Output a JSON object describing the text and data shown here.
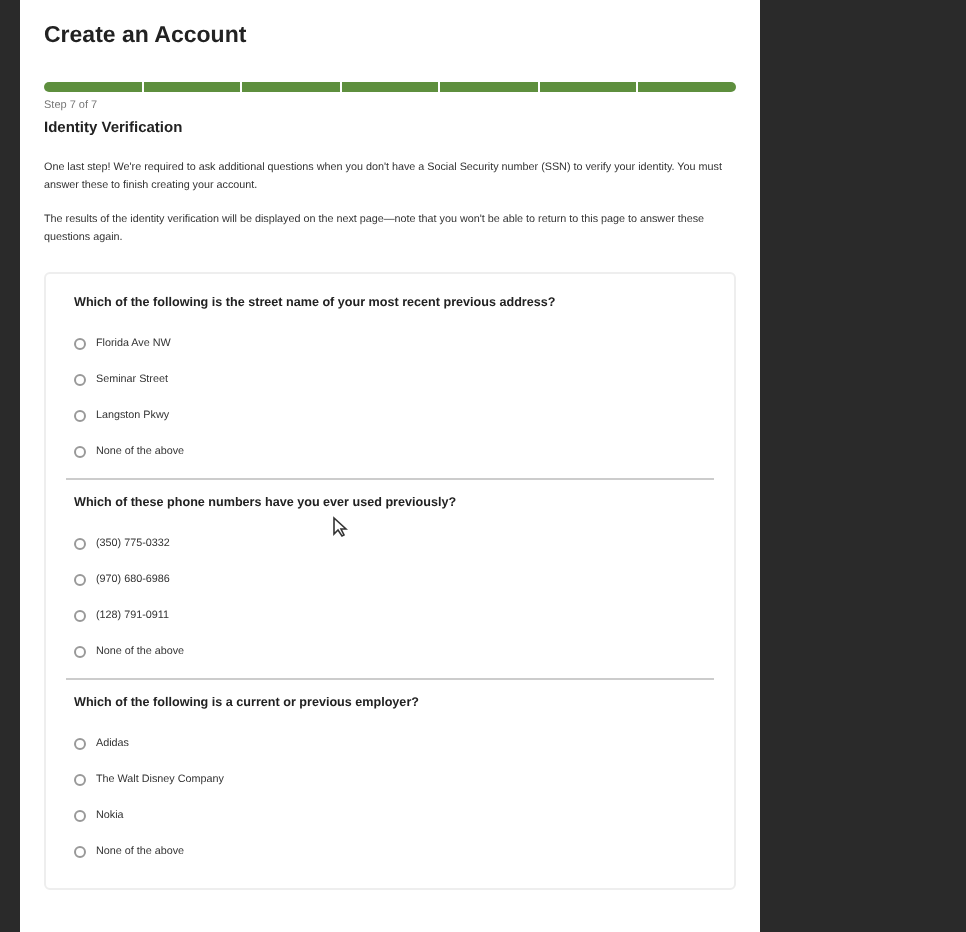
{
  "page": {
    "title": "Create an Account"
  },
  "progress": {
    "segments": [
      {
        "completed": true
      },
      {
        "completed": true
      },
      {
        "completed": true
      },
      {
        "completed": true
      },
      {
        "completed": true
      },
      {
        "completed": true
      },
      {
        "completed": true
      }
    ],
    "step_label": "Step 7 of 7"
  },
  "section": {
    "heading": "Identity Verification",
    "paragraphs": [
      "One last step! We're required to ask additional questions when you don't have a Social Security number (SSN) to verify your identity. You must answer these to finish creating your account.",
      "The results of the identity verification will be displayed on the next page—note that you won't be able to return to this page to answer these questions again."
    ]
  },
  "questions": [
    {
      "question": "Which of the following is the street name of your most recent previous address?",
      "options": [
        {
          "label": "Florida Ave NW",
          "selected": false
        },
        {
          "label": "Seminar Street",
          "selected": false
        },
        {
          "label": "Langston Pkwy",
          "selected": false
        },
        {
          "label": "None of the above",
          "selected": false
        }
      ]
    },
    {
      "question": "Which of these phone numbers have you ever used previously?",
      "options": [
        {
          "label": "(350) 775-0332",
          "selected": false
        },
        {
          "label": "(970) 680-6986",
          "selected": false
        },
        {
          "label": "(128) 791-0911",
          "selected": false
        },
        {
          "label": "None of the above",
          "selected": false
        }
      ]
    },
    {
      "question": "Which of the following is a current or previous employer?",
      "options": [
        {
          "label": "Adidas",
          "selected": false
        },
        {
          "label": "The Walt Disney Company",
          "selected": false
        },
        {
          "label": "Nokia",
          "selected": false
        },
        {
          "label": "None of the above",
          "selected": false
        }
      ]
    }
  ]
}
